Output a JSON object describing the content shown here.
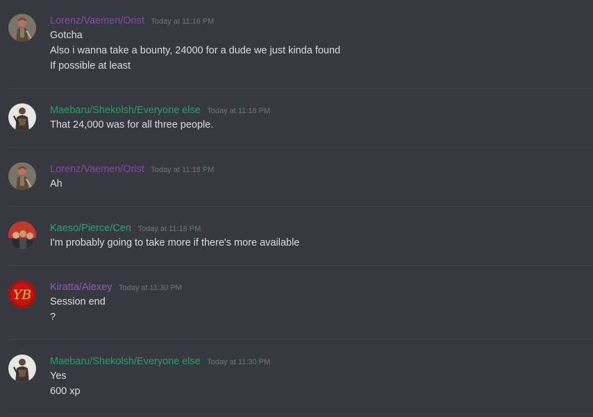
{
  "colors": {
    "background": "#36393f",
    "username_purple": "#8e44ad",
    "username_green": "#2a9d6c",
    "username_teal": "#2aa388",
    "username_violet": "#9b59b6",
    "timestamp": "#72767d",
    "text": "#dcddde"
  },
  "messages": [
    {
      "username": "Lorenz/Vaemen/Orist",
      "timestamp": "Today at 11:16 PM",
      "avatar_icon": "warrior-avatar-icon",
      "lines": [
        "Gotcha",
        "Also i wanna take a bounty, 24000 for a dude we just kinda found",
        "If possible at least"
      ]
    },
    {
      "username": "Maebaru/Shekolsh/Everyone else",
      "timestamp": "Today at 11:18 PM",
      "avatar_icon": "knight-avatar-icon",
      "lines": [
        "That 24,000 was for all three people."
      ]
    },
    {
      "username": "Lorenz/Vaemen/Orist",
      "timestamp": "Today at 11:18 PM",
      "avatar_icon": "warrior-avatar-icon",
      "lines": [
        "Ah"
      ]
    },
    {
      "username": "Kaeso/Pierce/Cen",
      "timestamp": "Today at 11:18 PM",
      "avatar_icon": "group-photo-avatar-icon",
      "lines": [
        "I'm probably going to take more if there's more available"
      ]
    },
    {
      "username": "Kiratta/Alexey",
      "timestamp": "Today at 11:30 PM",
      "avatar_icon": "yb-logo-avatar-icon",
      "avatar_text": "YB",
      "lines": [
        "Session end",
        "?"
      ]
    },
    {
      "username": "Maebaru/Shekolsh/Everyone else",
      "timestamp": "Today at 11:30 PM",
      "avatar_icon": "knight-avatar-icon",
      "lines": [
        "Yes",
        "600 xp"
      ]
    }
  ]
}
